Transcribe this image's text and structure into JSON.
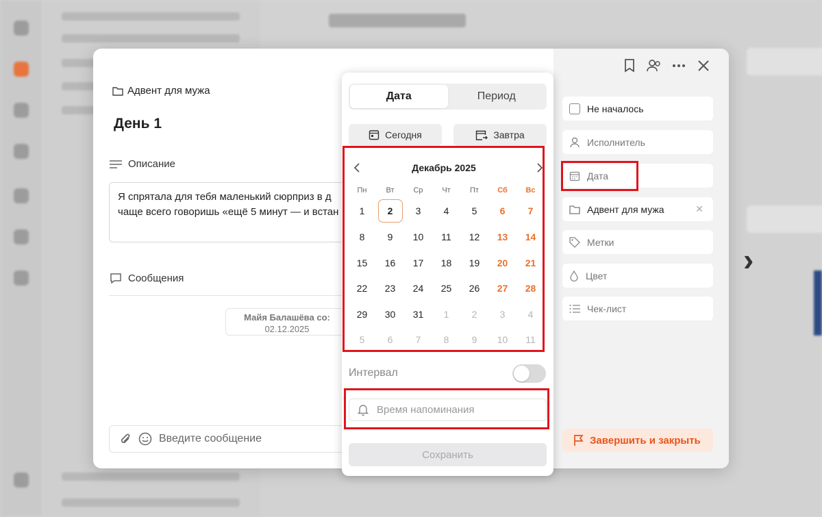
{
  "modal": {
    "breadcrumb": "Адвент для мужа",
    "title": "День 1",
    "description_label": "Описание",
    "description_lines": [
      "Я спрятала для тебя маленький сюрприз в д",
      "чаще всего говоришь «ещё 5 минут — и встан"
    ],
    "messages_label": "Сообщения",
    "message_author": "Майя Балашёва со:",
    "message_date": "02.12.2025",
    "composer_placeholder": "Введите сообщение"
  },
  "properties": {
    "status": "Не началось",
    "assignee": "Исполнитель",
    "date": "Дата",
    "project": "Адвент для мужа",
    "tags": "Метки",
    "color": "Цвет",
    "checklist": "Чек-лист",
    "finish": "Завершить и закрыть"
  },
  "picker": {
    "tabs": [
      "Дата",
      "Период"
    ],
    "today": "Сегодня",
    "tomorrow": "Завтра",
    "month": "Декабрь 2025",
    "weekdays": [
      "Пн",
      "Вт",
      "Ср",
      "Чт",
      "Пт",
      "Сб",
      "Вс"
    ],
    "weeks": [
      [
        "1",
        "2",
        "3",
        "4",
        "5",
        "6",
        "7"
      ],
      [
        "8",
        "9",
        "10",
        "11",
        "12",
        "13",
        "14"
      ],
      [
        "15",
        "16",
        "17",
        "18",
        "19",
        "20",
        "21"
      ],
      [
        "22",
        "23",
        "24",
        "25",
        "26",
        "27",
        "28"
      ],
      [
        "29",
        "30",
        "31",
        "1",
        "2",
        "3",
        "4"
      ],
      [
        "5",
        "6",
        "7",
        "8",
        "9",
        "10",
        "11"
      ]
    ],
    "interval": "Интервал",
    "reminder_placeholder": "Время напоминания",
    "save": "Сохранить"
  },
  "colors": {
    "accent": "#e8722d",
    "highlight": "#e0141c"
  }
}
